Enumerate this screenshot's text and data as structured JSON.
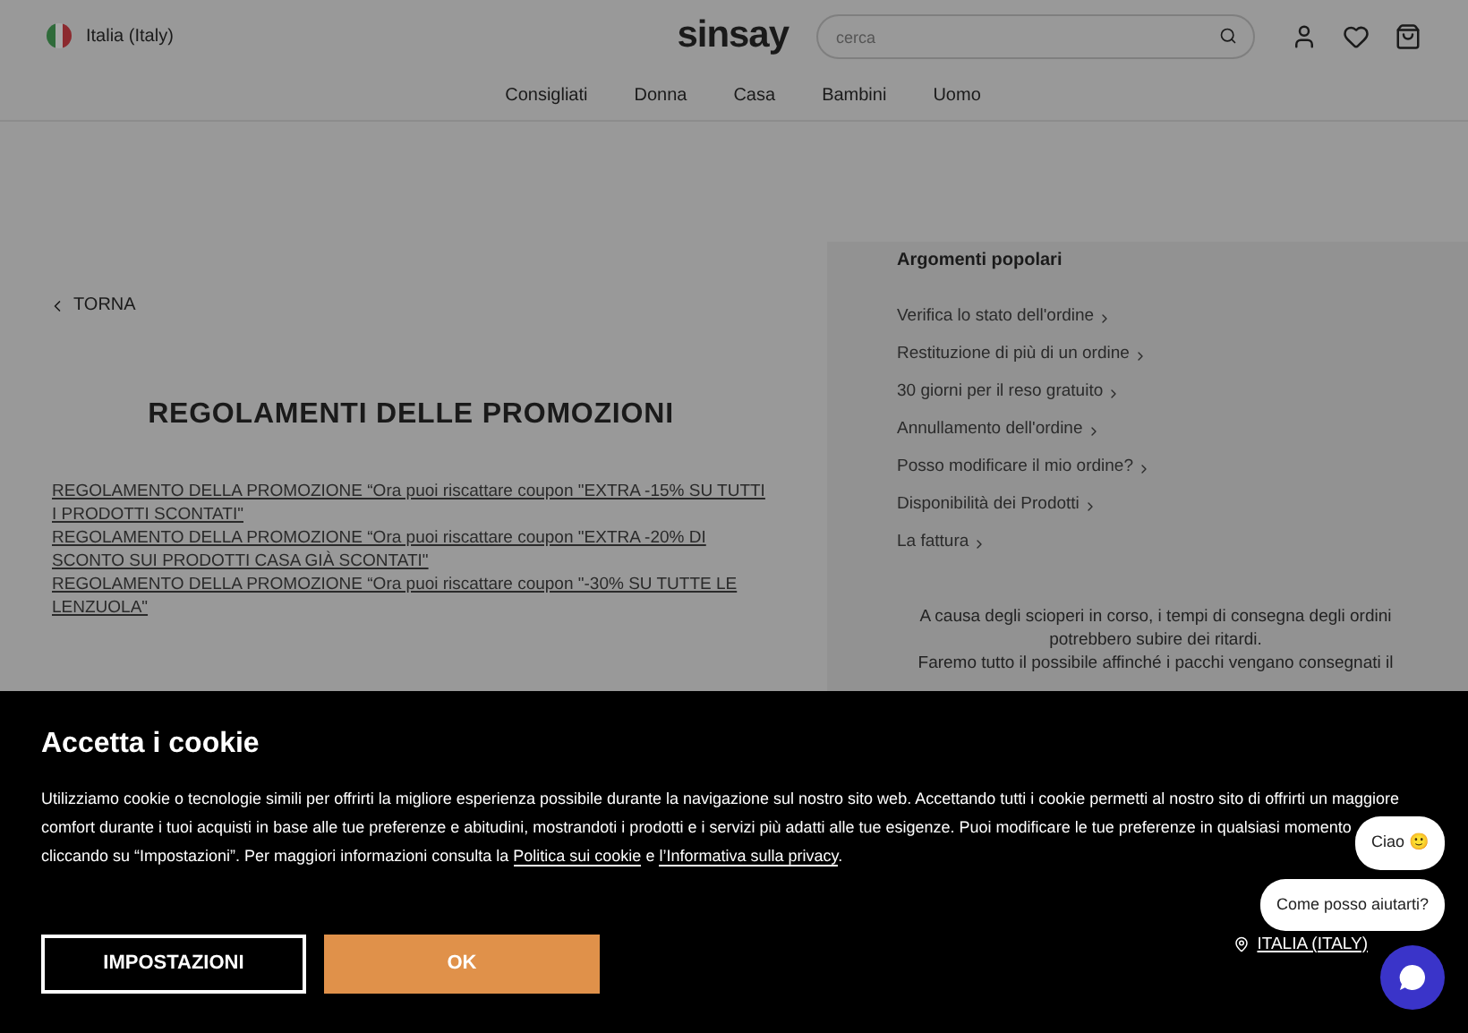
{
  "header": {
    "country": "Italia (Italy)",
    "logo": "sinsay",
    "search": {
      "placeholder": "cerca"
    }
  },
  "nav": [
    "Consigliati",
    "Donna",
    "Casa",
    "Bambini",
    "Uomo"
  ],
  "back_link": "TORNA",
  "title": "REGOLAMENTI DELLE PROMOZIONI",
  "promotions": [
    "REGOLAMENTO DELLA PROMOZIONE “Ora puoi riscattare coupon \"EXTRA -15% SU TUTTI I PRODOTTI SCONTATI\"",
    "REGOLAMENTO DELLA PROMOZIONE “Ora puoi riscattare coupon \"EXTRA -20% DI SCONTO SUI PRODOTTI CASA GIÀ SCONTATI\"",
    "REGOLAMENTO DELLA PROMOZIONE “Ora puoi riscattare coupon \"-30% SU TUTTE LE LENZUOLA\""
  ],
  "popular": {
    "title": "Argomenti popolari",
    "items": [
      "Verifica lo stato dell'ordine",
      "Restituzione di più di un ordine",
      "30 giorni per il reso gratuito",
      "Annullamento dell'ordine",
      "Posso modificare il mio ordine?",
      "Disponibilità dei Prodotti",
      "La fattura"
    ],
    "notice": [
      "A causa degli scioperi in corso, i tempi di consegna degli ordini potrebbero subire dei ritardi.",
      "Faremo tutto il possibile affinché i pacchi vengano consegnati il"
    ]
  },
  "cookie_banner": {
    "title": "Accetta i cookie",
    "text": "Utilizziamo cookie o tecnologie simili per offrirti la migliore esperienza possibile durante la navigazione sul nostro sito web. Accettando tutti i cookie permetti al nostro sito di offrirti un maggiore comfort durante i tuoi acquisti in base alle tue preferenze e abitudini, mostrandoti i prodotti e i servizi più adatti alle tue esigenze. Puoi modificare le tue preferenze in qualsiasi momento cliccando su “Impostazioni”. Per maggiori informazioni consulta la",
    "link_1": "Politica sui cookie",
    "joiner": "e",
    "link_2": "l’Informativa sulla privacy",
    "end": ".",
    "buttons": [
      "IMPOSTAZIONI",
      "OK"
    ],
    "location": "ITALIA (ITALY)"
  },
  "chat": {
    "bubbles": [
      "Ciao 🙂",
      "Come posso aiutarti?"
    ]
  }
}
